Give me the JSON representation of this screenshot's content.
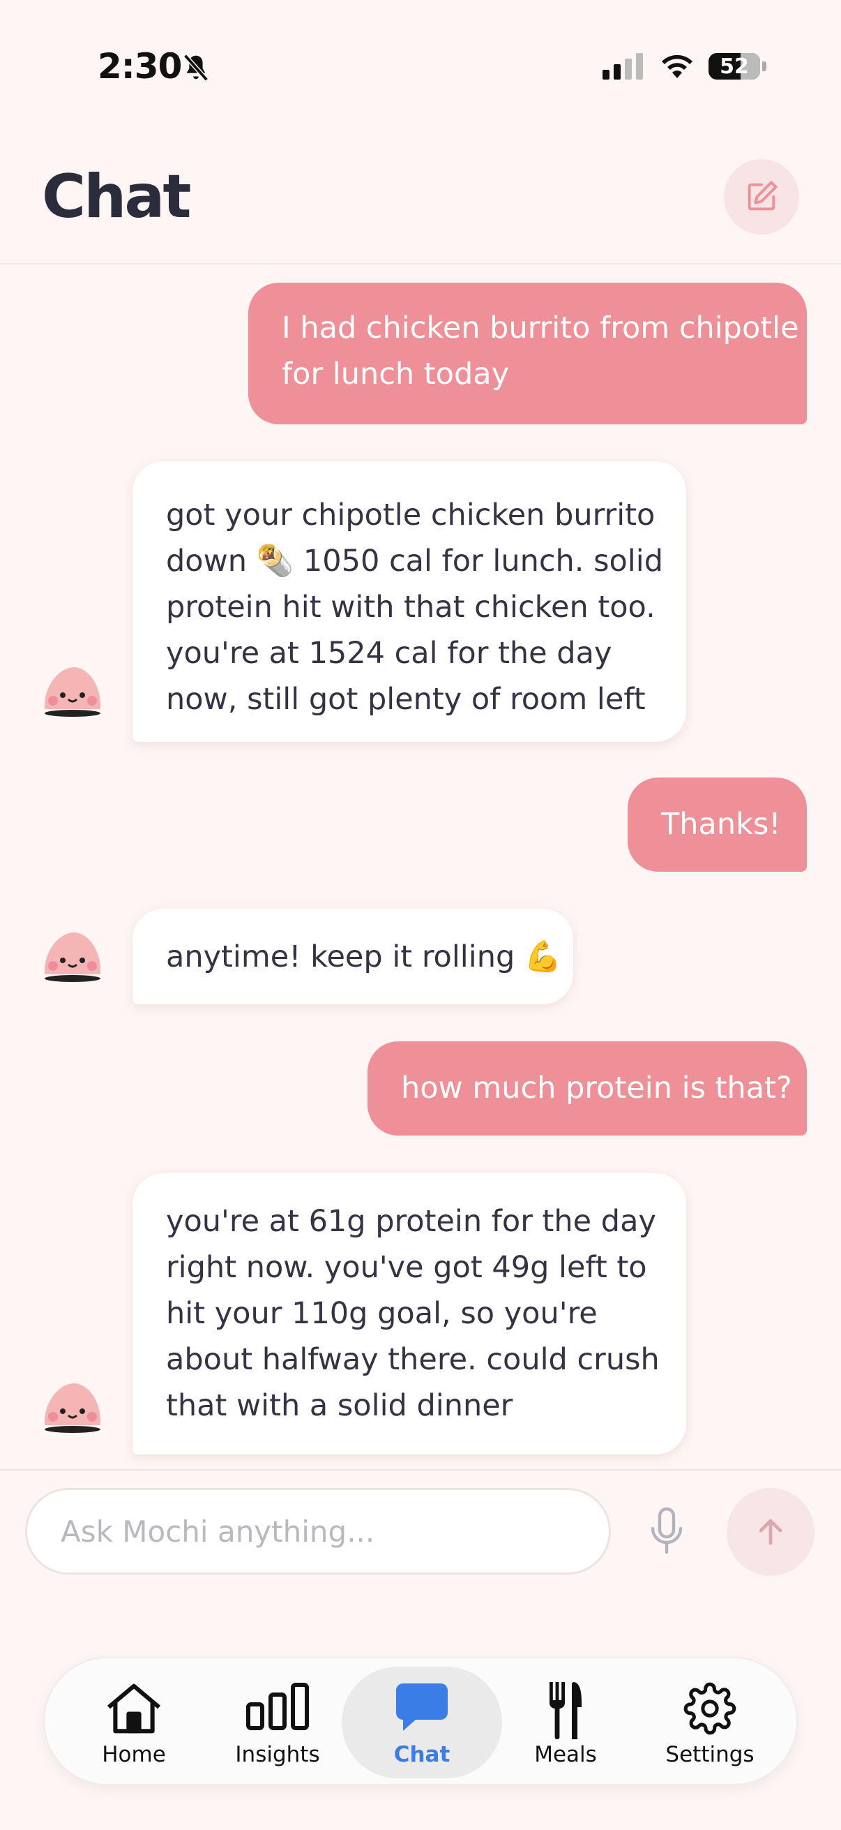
{
  "status_bar": {
    "time": "2:30",
    "battery": "52"
  },
  "header": {
    "title": "Chat",
    "compose_icon": "compose-icon"
  },
  "messages": [
    {
      "role": "user",
      "lines": [
        "I had chicken burrito from chipotle",
        "for lunch today"
      ]
    },
    {
      "role": "bot",
      "lines": [
        "got your chipotle chicken burrito",
        "down 🌯 1050 cal for lunch. solid",
        "protein hit with that chicken too.",
        "you're at 1524 cal for the day",
        "now, still got plenty of room left"
      ]
    },
    {
      "role": "user",
      "lines": [
        "Thanks!"
      ]
    },
    {
      "role": "bot",
      "lines": [
        "anytime! keep it rolling 💪"
      ]
    },
    {
      "role": "user",
      "lines": [
        "how much protein is that?"
      ]
    },
    {
      "role": "bot",
      "lines": [
        "you're at 61g protein for the day",
        "right now. you've got 49g left to",
        "hit your 110g goal, so you're",
        "about halfway there. could crush",
        "that with a solid dinner"
      ]
    }
  ],
  "input": {
    "placeholder": "Ask Mochi anything...",
    "value": ""
  },
  "tabs": [
    {
      "label": "Home",
      "icon": "home-icon",
      "active": false
    },
    {
      "label": "Insights",
      "icon": "bar-chart-icon",
      "active": false
    },
    {
      "label": "Chat",
      "icon": "chat-bubble-icon",
      "active": true
    },
    {
      "label": "Meals",
      "icon": "fork-knife-icon",
      "active": false
    },
    {
      "label": "Settings",
      "icon": "gear-icon",
      "active": false
    }
  ],
  "colors": {
    "accent_pink": "#ef8f98",
    "active_tab": "#3b7de6",
    "background": "#fdf6f4"
  }
}
